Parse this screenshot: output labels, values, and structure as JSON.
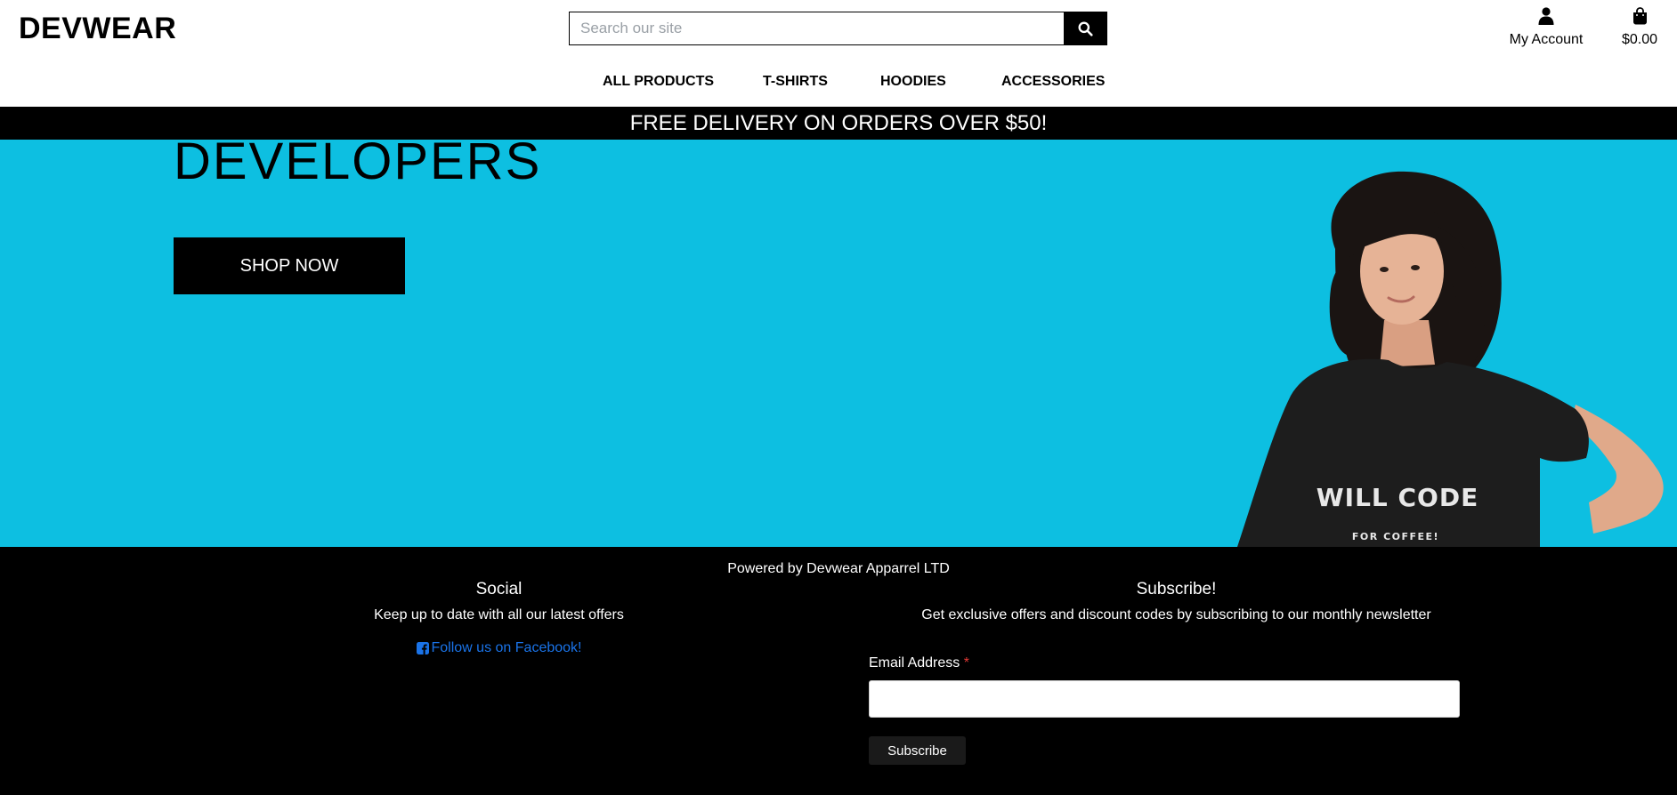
{
  "brand": {
    "logo": "DEVWEAR"
  },
  "search": {
    "placeholder": "Search our site",
    "value": ""
  },
  "account": {
    "label": "My Account",
    "icon": "user-icon"
  },
  "cart": {
    "total": "$0.00",
    "icon": "shopping-bag-icon"
  },
  "nav": {
    "items": [
      "ALL PRODUCTS",
      "T-SHIRTS",
      "HOODIES",
      "ACCESSORIES"
    ]
  },
  "banner": {
    "text": "FREE DELIVERY ON ORDERS OVER $50!"
  },
  "hero": {
    "title": "DEVELOPERS",
    "cta": "SHOP NOW",
    "shirt_text_main": "WILL CODE",
    "shirt_text_sub": "FOR COFFEE!",
    "bg_color": "#0dbfe1"
  },
  "footer": {
    "powered_by": "Powered by Devwear Apparrel LTD",
    "social": {
      "title": "Social",
      "text": "Keep up to date with all our latest offers",
      "link": "Follow us on Facebook!",
      "icon": "facebook-square-icon"
    },
    "subscribe": {
      "title": "Subscribe!",
      "text": "Get exclusive offers and discount codes by subscribing to our monthly newsletter",
      "email_label": "Email Address",
      "required_mark": "*",
      "email_value": "",
      "button": "Subscribe"
    },
    "link_color": "#1a73e8"
  }
}
